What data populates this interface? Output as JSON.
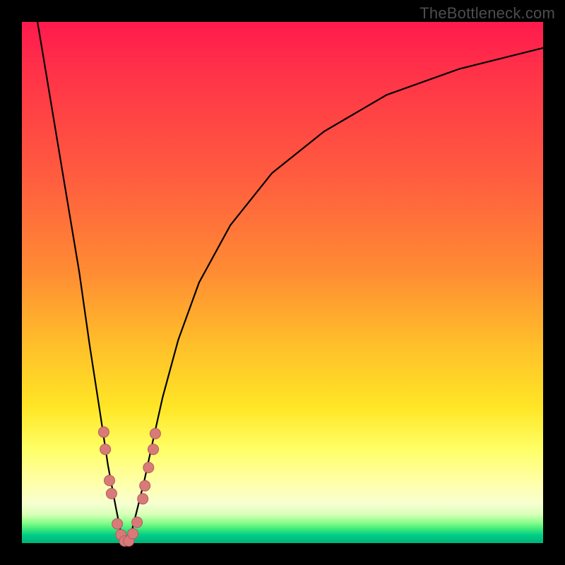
{
  "watermark": {
    "text": "TheBottleneck.com"
  },
  "colors": {
    "frame": "#000000",
    "curve": "#000000",
    "marker_fill": "#d97a7a",
    "marker_stroke": "#b35a5a"
  },
  "chart_data": {
    "type": "line",
    "title": "",
    "xlabel": "",
    "ylabel": "",
    "xlim": [
      0,
      100
    ],
    "ylim": [
      0,
      100
    ],
    "grid": false,
    "legend": false,
    "note": "Axes unlabeled in source; x and y are normalized 0–100. y≈100 at top (max bottleneck), y≈0 at valley (no bottleneck). Valley at x≈20.",
    "series": [
      {
        "name": "bottleneck-curve",
        "x": [
          3,
          5,
          8,
          11,
          13,
          15,
          16.5,
          18,
          19,
          20,
          21,
          22,
          23.5,
          25,
          27,
          30,
          34,
          40,
          48,
          58,
          70,
          84,
          100
        ],
        "y": [
          100,
          88,
          70,
          52,
          38,
          25,
          15,
          7,
          2,
          0,
          2,
          6,
          12,
          19,
          28,
          39,
          50,
          61,
          71,
          79,
          86,
          91,
          95
        ]
      }
    ],
    "markers": {
      "name": "highlighted-points",
      "note": "Pink dots clustered around the valley",
      "points": [
        {
          "x": 15.7,
          "y": 21.3
        },
        {
          "x": 16.0,
          "y": 18.0
        },
        {
          "x": 16.8,
          "y": 12.0
        },
        {
          "x": 17.2,
          "y": 9.5
        },
        {
          "x": 18.3,
          "y": 3.7
        },
        {
          "x": 19.0,
          "y": 1.6
        },
        {
          "x": 19.7,
          "y": 0.4
        },
        {
          "x": 20.5,
          "y": 0.4
        },
        {
          "x": 21.3,
          "y": 1.8
        },
        {
          "x": 22.1,
          "y": 4.0
        },
        {
          "x": 23.2,
          "y": 8.5
        },
        {
          "x": 23.6,
          "y": 11.0
        },
        {
          "x": 24.3,
          "y": 14.5
        },
        {
          "x": 25.2,
          "y": 18.0
        },
        {
          "x": 25.6,
          "y": 21.0
        }
      ]
    }
  }
}
